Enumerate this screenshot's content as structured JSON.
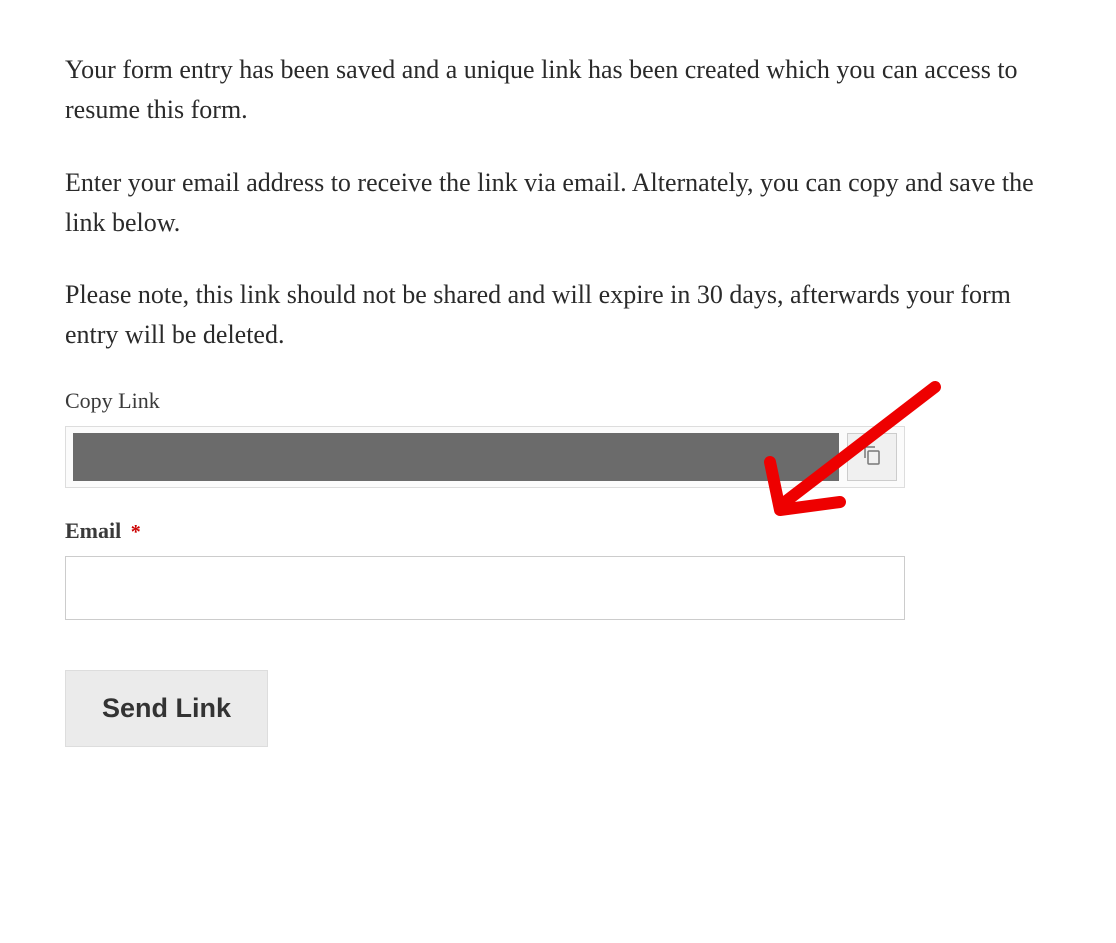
{
  "intro": {
    "para1": "Your form entry has been saved and a unique link has been created which you can access to resume this form.",
    "para2": "Enter your email address to receive the link via email. Alternately, you can copy and save the link below.",
    "para3": "Please note, this link should not be shared and will expire in 30 days, afterwards your form entry will be deleted."
  },
  "copyLink": {
    "label": "Copy Link"
  },
  "email": {
    "label": "Email",
    "requiredMark": "*",
    "value": ""
  },
  "button": {
    "label": "Send Link"
  }
}
